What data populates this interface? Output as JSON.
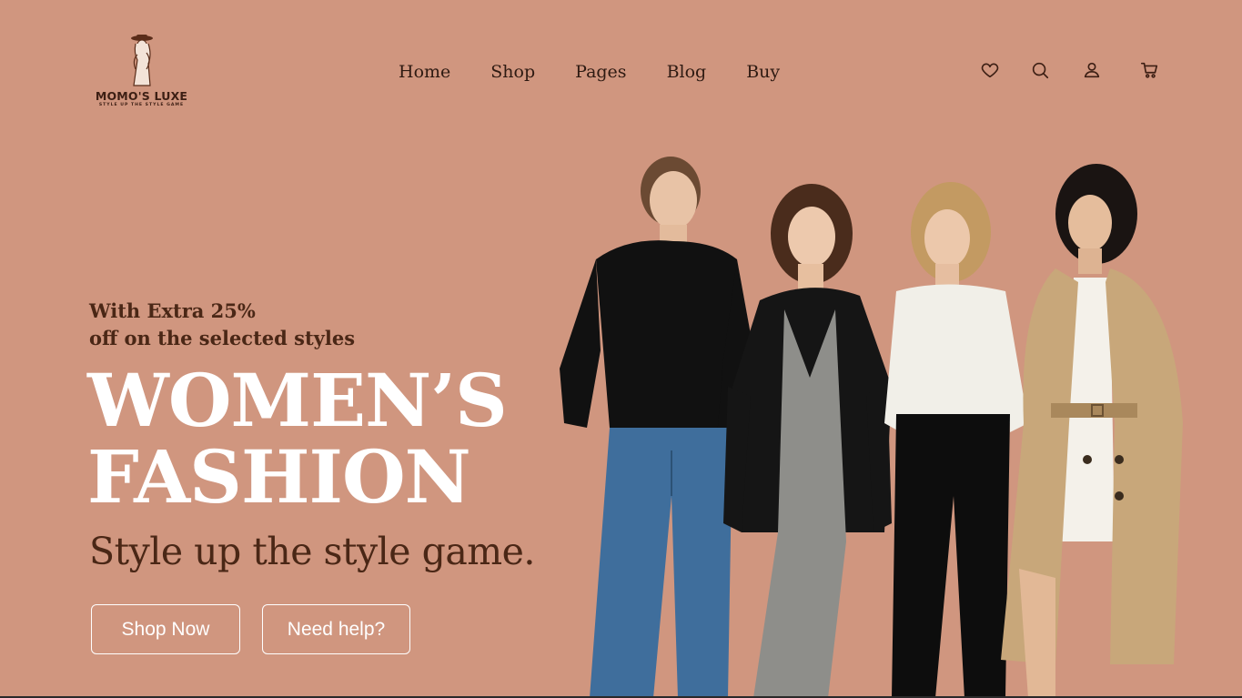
{
  "brand": {
    "name": "MOMO'S LUXE",
    "tagline": "STYLE UP THE STYLE GAME"
  },
  "nav": {
    "items": [
      {
        "label": "Home"
      },
      {
        "label": "Shop"
      },
      {
        "label": "Pages"
      },
      {
        "label": "Blog"
      },
      {
        "label": "Buy"
      }
    ]
  },
  "header_icons": [
    "heart-icon",
    "search-icon",
    "user-icon",
    "cart-icon"
  ],
  "hero": {
    "promo_line1": "With Extra 25%",
    "promo_line2": "off on the selected styles",
    "title_line1": "WOMEN’S",
    "title_line2": "FASHION",
    "subtitle": "Style up the style game.",
    "primary_button": "Shop Now",
    "secondary_button": "Need help?"
  },
  "colors": {
    "background": "#d0967f",
    "accent_dark": "#4a2716",
    "title": "#ffffff"
  }
}
